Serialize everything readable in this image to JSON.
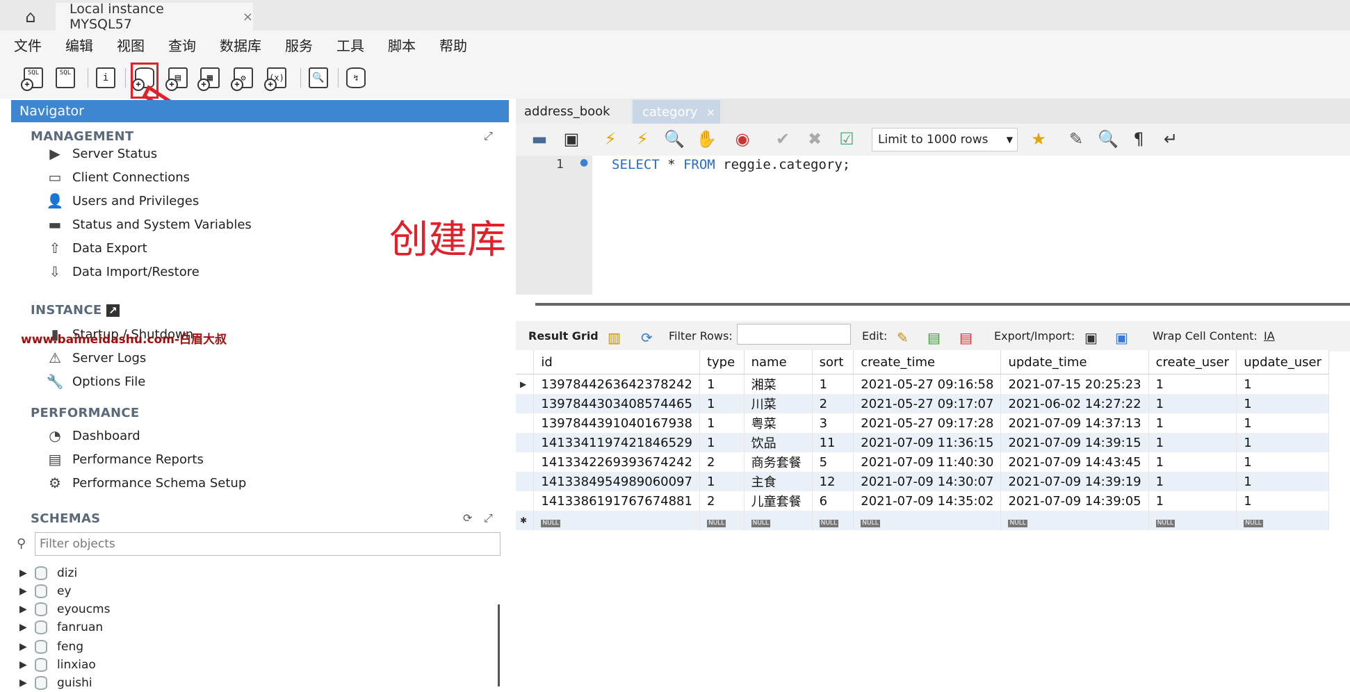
{
  "window": {
    "connection_tab": "Local instance MYSQL57",
    "close_glyph": "×"
  },
  "menu": [
    "文件",
    "编辑",
    "视图",
    "查询",
    "数据库",
    "服务",
    "工具",
    "脚本",
    "帮助"
  ],
  "navigator": {
    "title": "Navigator",
    "management": {
      "title": "MANAGEMENT",
      "items": [
        "Server Status",
        "Client Connections",
        "Users and Privileges",
        "Status and System Variables",
        "Data Export",
        "Data Import/Restore"
      ]
    },
    "instance": {
      "title": "INSTANCE",
      "items": [
        "Startup / Shutdown",
        "Server Logs",
        "Options File"
      ]
    },
    "performance": {
      "title": "PERFORMANCE",
      "items": [
        "Dashboard",
        "Performance Reports",
        "Performance Schema Setup"
      ]
    },
    "schemas": {
      "title": "SCHEMAS",
      "filter_placeholder": "Filter objects",
      "items": [
        "dizi",
        "ey",
        "eyoucms",
        "fanruan",
        "feng",
        "linxiao",
        "guishi"
      ]
    }
  },
  "annotation": {
    "text": "创建库",
    "color": "#e3202a"
  },
  "watermark": "www.baimeidashu.com-白眉大叔",
  "query_tabs": [
    "address_book",
    "category"
  ],
  "query_toolbar": {
    "limit": "Limit to 1000 rows"
  },
  "editor": {
    "line": "1",
    "sql_kw1": "SELECT",
    "sql_mid": " * ",
    "sql_kw2": "FROM",
    "sql_rest": " reggie.category;"
  },
  "result_toolbar": {
    "result_grid": "Result Grid",
    "filter_rows": "Filter Rows:",
    "edit": "Edit:",
    "export_import": "Export/Import:",
    "wrap": "Wrap Cell Content:"
  },
  "grid": {
    "columns": [
      "id",
      "type",
      "name",
      "sort",
      "create_time",
      "update_time",
      "create_user",
      "update_user"
    ],
    "rows": [
      [
        "1397844263642378242",
        "1",
        "湘菜",
        "1",
        "2021-05-27 09:16:58",
        "2021-07-15 20:25:23",
        "1",
        "1"
      ],
      [
        "1397844303408574465",
        "1",
        "川菜",
        "2",
        "2021-05-27 09:17:07",
        "2021-06-02 14:27:22",
        "1",
        "1"
      ],
      [
        "1397844391040167938",
        "1",
        "粤菜",
        "3",
        "2021-05-27 09:17:28",
        "2021-07-09 14:37:13",
        "1",
        "1"
      ],
      [
        "1413341197421846529",
        "1",
        "饮品",
        "11",
        "2021-07-09 11:36:15",
        "2021-07-09 14:39:15",
        "1",
        "1"
      ],
      [
        "1413342269393674242",
        "2",
        "商务套餐",
        "5",
        "2021-07-09 11:40:30",
        "2021-07-09 14:43:45",
        "1",
        "1"
      ],
      [
        "1413384954989060097",
        "1",
        "主食",
        "12",
        "2021-07-09 14:30:07",
        "2021-07-09 14:39:19",
        "1",
        "1"
      ],
      [
        "1413386191767674881",
        "2",
        "儿童套餐",
        "6",
        "2021-07-09 14:35:02",
        "2021-07-09 14:39:05",
        "1",
        "1"
      ]
    ],
    "null_label": "NULL"
  }
}
